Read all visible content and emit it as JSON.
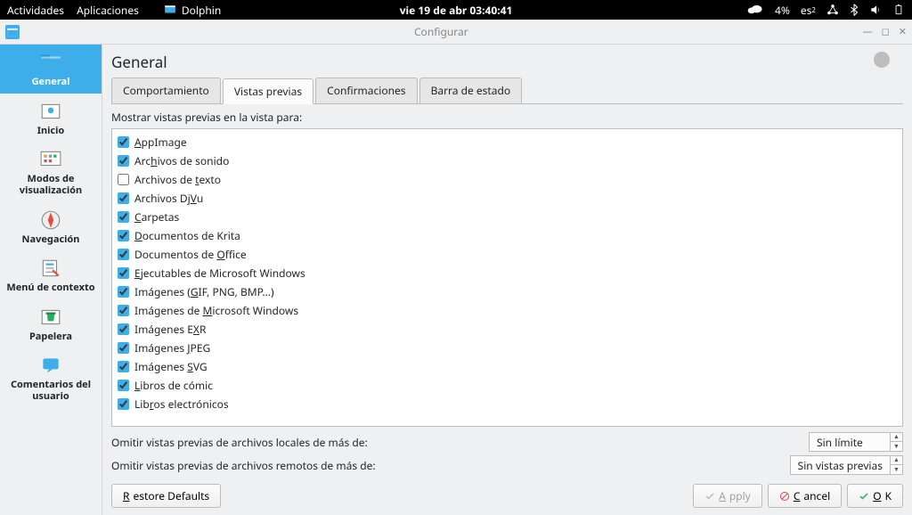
{
  "panel": {
    "activities": "Actividades",
    "applications": "Aplicaciones",
    "app_name": "Dolphin",
    "clock": "vie 19 de abr  03:40:41",
    "battery_pct": "4%",
    "kbd_layout": "es",
    "kbd_sub": "2"
  },
  "window": {
    "title": "Configurar"
  },
  "sidebar": {
    "items": [
      {
        "label": "General"
      },
      {
        "label": "Inicio"
      },
      {
        "label": "Modos de visualización"
      },
      {
        "label": "Navegación"
      },
      {
        "label": "Menú de contexto"
      },
      {
        "label": "Papelera"
      },
      {
        "label": "Comentarios del usuario"
      }
    ]
  },
  "page_title": "General",
  "tabs": {
    "items": [
      "Comportamiento",
      "Vistas previas",
      "Confirmaciones",
      "Barra de estado"
    ],
    "active": 1
  },
  "section_label": "Mostrar vistas previas en la vista para:",
  "filetypes": [
    {
      "label": "AppImage",
      "checked": true,
      "accel": "A"
    },
    {
      "label": "Archivos de sonido",
      "checked": true,
      "accel": "h"
    },
    {
      "label": "Archivos de texto",
      "checked": false,
      "accel": "t"
    },
    {
      "label": "Archivos DjVu",
      "checked": true,
      "accel": "V"
    },
    {
      "label": "Carpetas",
      "checked": true,
      "accel": "C"
    },
    {
      "label": "Documentos de Krita",
      "checked": true,
      "accel": "D"
    },
    {
      "label": "Documentos de Office",
      "checked": true,
      "accel": "O"
    },
    {
      "label": "Ejecutables de Microsoft Windows",
      "checked": true,
      "accel": "E"
    },
    {
      "label": "Imágenes (GIF, PNG, BMP...)",
      "checked": true,
      "accel": "G"
    },
    {
      "label": "Imágenes de Microsoft Windows",
      "checked": true,
      "accel": "M"
    },
    {
      "label": "Imágenes EXR",
      "checked": true,
      "accel": "X"
    },
    {
      "label": "Imágenes JPEG",
      "checked": true,
      "accel": "J"
    },
    {
      "label": "Imágenes SVG",
      "checked": true,
      "accel": "S"
    },
    {
      "label": "Libros de cómic",
      "checked": true,
      "accel": "L"
    },
    {
      "label": "Libros electrónicos",
      "checked": true,
      "accel": "r"
    }
  ],
  "limits": {
    "local_label": "Omitir vistas previas de archivos locales de más de:",
    "local_value": "Sin límite",
    "remote_label": "Omitir vistas previas de archivos remotos de más de:",
    "remote_value": "Sin vistas previas"
  },
  "buttons": {
    "restore": "Restore Defaults",
    "apply": "Apply",
    "cancel": "Cancel",
    "ok": "OK"
  }
}
